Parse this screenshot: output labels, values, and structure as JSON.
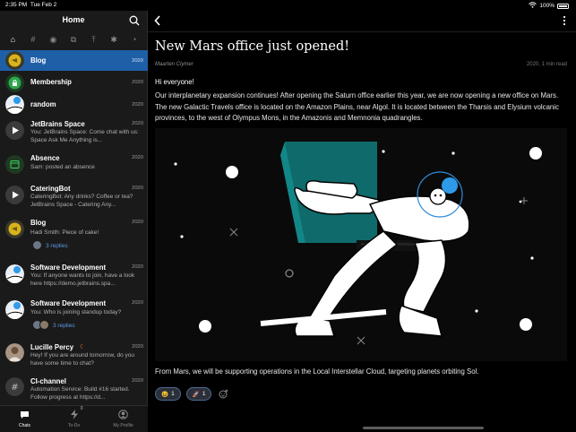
{
  "status": {
    "time": "2:35 PM",
    "date": "Tue Feb 2",
    "battery": "100%"
  },
  "sidebar": {
    "title": "Home",
    "filters": [
      {
        "icon": "home-icon",
        "glyph": "⌂"
      },
      {
        "icon": "hash-icon",
        "glyph": "#"
      },
      {
        "icon": "person-icon",
        "glyph": "◉"
      },
      {
        "icon": "copy-icon",
        "glyph": "⧉"
      },
      {
        "icon": "upload-icon",
        "glyph": "⤒"
      },
      {
        "icon": "asterisk-icon",
        "glyph": "✱"
      },
      {
        "icon": "timer-icon",
        "glyph": "◔"
      }
    ],
    "channels": [
      {
        "name": "Blog",
        "date": "2020",
        "preview": "",
        "replies": "",
        "avatar": "yellow-fish",
        "selected": true
      },
      {
        "name": "Membership",
        "date": "2020",
        "preview": "",
        "replies": "",
        "avatar": "green-lock"
      },
      {
        "name": "random",
        "date": "2020",
        "preview": "",
        "replies": "",
        "avatar": "space-planet"
      },
      {
        "name": "JetBrains Space",
        "date": "2020",
        "preview": "You: JetBrains Space: Come chat with us: Space Ask Me Anything is...",
        "replies": "",
        "avatar": "play-grey"
      },
      {
        "name": "Absence",
        "date": "2020",
        "preview": "Sam: posted an absence",
        "replies": "",
        "avatar": "green-calendar"
      },
      {
        "name": "CateringBot",
        "date": "2020",
        "preview": "CateringBot: Any drinks? Coffee or tea? JetBrains Space - Catering Any...",
        "replies": "",
        "avatar": "play-grey"
      },
      {
        "name": "Blog",
        "date": "2020",
        "preview": "Hadi Smith: Piece of cake!",
        "replies": "3 replies",
        "avatar": "yellow-fish"
      },
      {
        "name": "Software Development",
        "date": "2020",
        "preview": "You: If anyone wants to join, have a look here https://demo.jetbrains.spa...",
        "replies": "",
        "avatar": "space-planet"
      },
      {
        "name": "Software Development",
        "date": "2020",
        "preview": "You: Who is joining standup today?",
        "replies": "3 replies",
        "avatar": "space-planet"
      },
      {
        "name": "Lucille Percy",
        "date": "2020",
        "preview": "Hey! If you are around tomorrow, do you have some time to chat?",
        "replies": "",
        "avatar": "person-photo",
        "status_icon": "moon-icon"
      },
      {
        "name": "CI-channel",
        "date": "2020",
        "preview": "Automation Service: Build #16 started. Follow progress at https://d...",
        "replies": "",
        "avatar": "hash-grey"
      }
    ],
    "tabs": [
      {
        "label": "Chats",
        "icon": "chat-icon",
        "active": true
      },
      {
        "label": "To-Do",
        "icon": "bolt-icon",
        "badge": "0"
      },
      {
        "label": "My Profile",
        "icon": "profile-icon"
      }
    ]
  },
  "article": {
    "title": "New Mars office just opened!",
    "author": "Maarten Clymer",
    "meta": "2020, 1 min read",
    "greeting": "Hi everyone!",
    "paragraph1": "Our interplanetary expansion continues! After opening the Saturn office earlier this year, we are now opening a new office on Mars. The new Galactic Travels office is located on the Amazon Plains, near Algol. It is located between the Tharsis and Elysium volcanic provinces, to the west of Olympus Mons, in the Amazonis and Memnonia quadrangles.",
    "paragraph2": "From Mars, we will be supporting operations in the Local Interstellar Cloud, targeting planets orbiting Sol.",
    "reactions": [
      {
        "emoji": "😆",
        "count": "1"
      },
      {
        "emoji": "🚀",
        "count": "1"
      }
    ]
  },
  "colors": {
    "selected": "#1f5fa8",
    "sidebar_bg": "#1a1a1a",
    "link": "#5b9be6",
    "teal": "#0f6b6b"
  }
}
